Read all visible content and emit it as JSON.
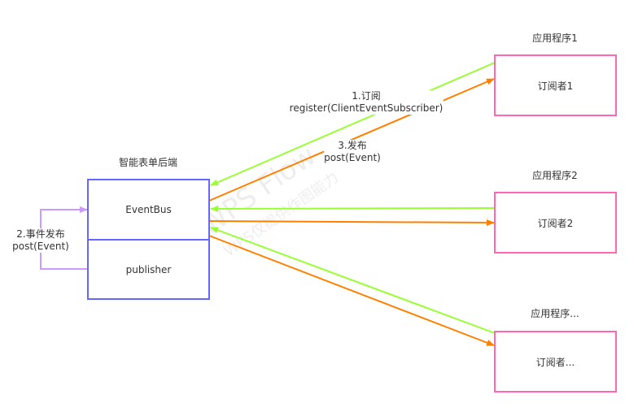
{
  "backend": {
    "title": "智能表单后端",
    "eventbus": "EventBus",
    "publisher": "publisher"
  },
  "apps": [
    {
      "title": "应用程序1",
      "subscriber": "订阅者1"
    },
    {
      "title": "应用程序2",
      "subscriber": "订阅者2"
    },
    {
      "title": "应用程序...",
      "subscriber": "订阅者..."
    }
  ],
  "edges": {
    "subscribe": {
      "line1": "1.订阅",
      "line2": "register(ClientEventSubscriber)"
    },
    "self_publish": {
      "line1": "2.事件发布",
      "line2": "post(Event)"
    },
    "publish": {
      "line1": "3.发布",
      "line2": "post(Event)"
    }
  },
  "watermark": {
    "line1": "WPS Flow",
    "line2": "WPS仅提供作图能力"
  },
  "colors": {
    "backend_border": "#6666ff",
    "app_border": "#ff66b3",
    "subscribe_arrow": "#99ff33",
    "publish_arrow": "#ff8000",
    "self_arrow": "#cc99ff"
  }
}
